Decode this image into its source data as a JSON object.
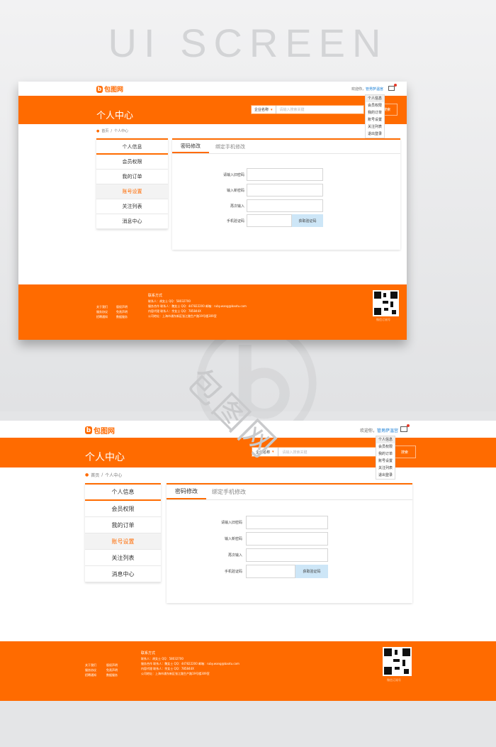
{
  "showcase": {
    "title": "UI SCREEN",
    "watermark": "包图网"
  },
  "header": {
    "logo_mark": "b",
    "logo_text": "包图网",
    "welcome": "欢迎你，",
    "username": "管男萨温宫"
  },
  "hero": {
    "title": "个人中心",
    "search_category": "企业名称",
    "search_placeholder": "请输入搜索关键",
    "search_button": "搜索"
  },
  "user_dropdown": [
    "个人信息",
    "会员权限",
    "我的订单",
    "账号设置",
    "关注列表",
    "退出登录"
  ],
  "breadcrumb": {
    "home": "首页",
    "sep": "/",
    "current": "个人中心"
  },
  "sidebar": [
    "个人信息",
    "会员权限",
    "我的订单",
    "账号设置",
    "关注列表",
    "消息中心"
  ],
  "tabs": [
    "密码修改",
    "绑定手机修改"
  ],
  "form": {
    "old_password_label": "请输入旧密码",
    "new_password_label": "输入新密码",
    "confirm_label": "再次输入",
    "phone_code_label": "手机验证码",
    "get_code_button": "获取验证码"
  },
  "footer": {
    "links_col1": [
      "关于我们",
      "服务协议",
      "招聘通知"
    ],
    "links_col2": [
      "版权声明",
      "免责声明",
      "数据服务"
    ],
    "contact_title": "联系方式",
    "contact_lines": [
      "联系人：胡女士   QQ：58032700",
      "服务合作   联系人：魏女士   QQ：447822200   邮箱：ruby.wang@baotu.com",
      "内容代理   联系人：余女士   QQ：785844X",
      "公司地址：上海市浦东新区张江路生产路19号楼309室"
    ],
    "qr_caption": "微信订阅号"
  },
  "colors": {
    "brand_orange": "#ff6b00",
    "link_blue": "#1a7fd6",
    "code_button_bg": "#cde6f7"
  }
}
